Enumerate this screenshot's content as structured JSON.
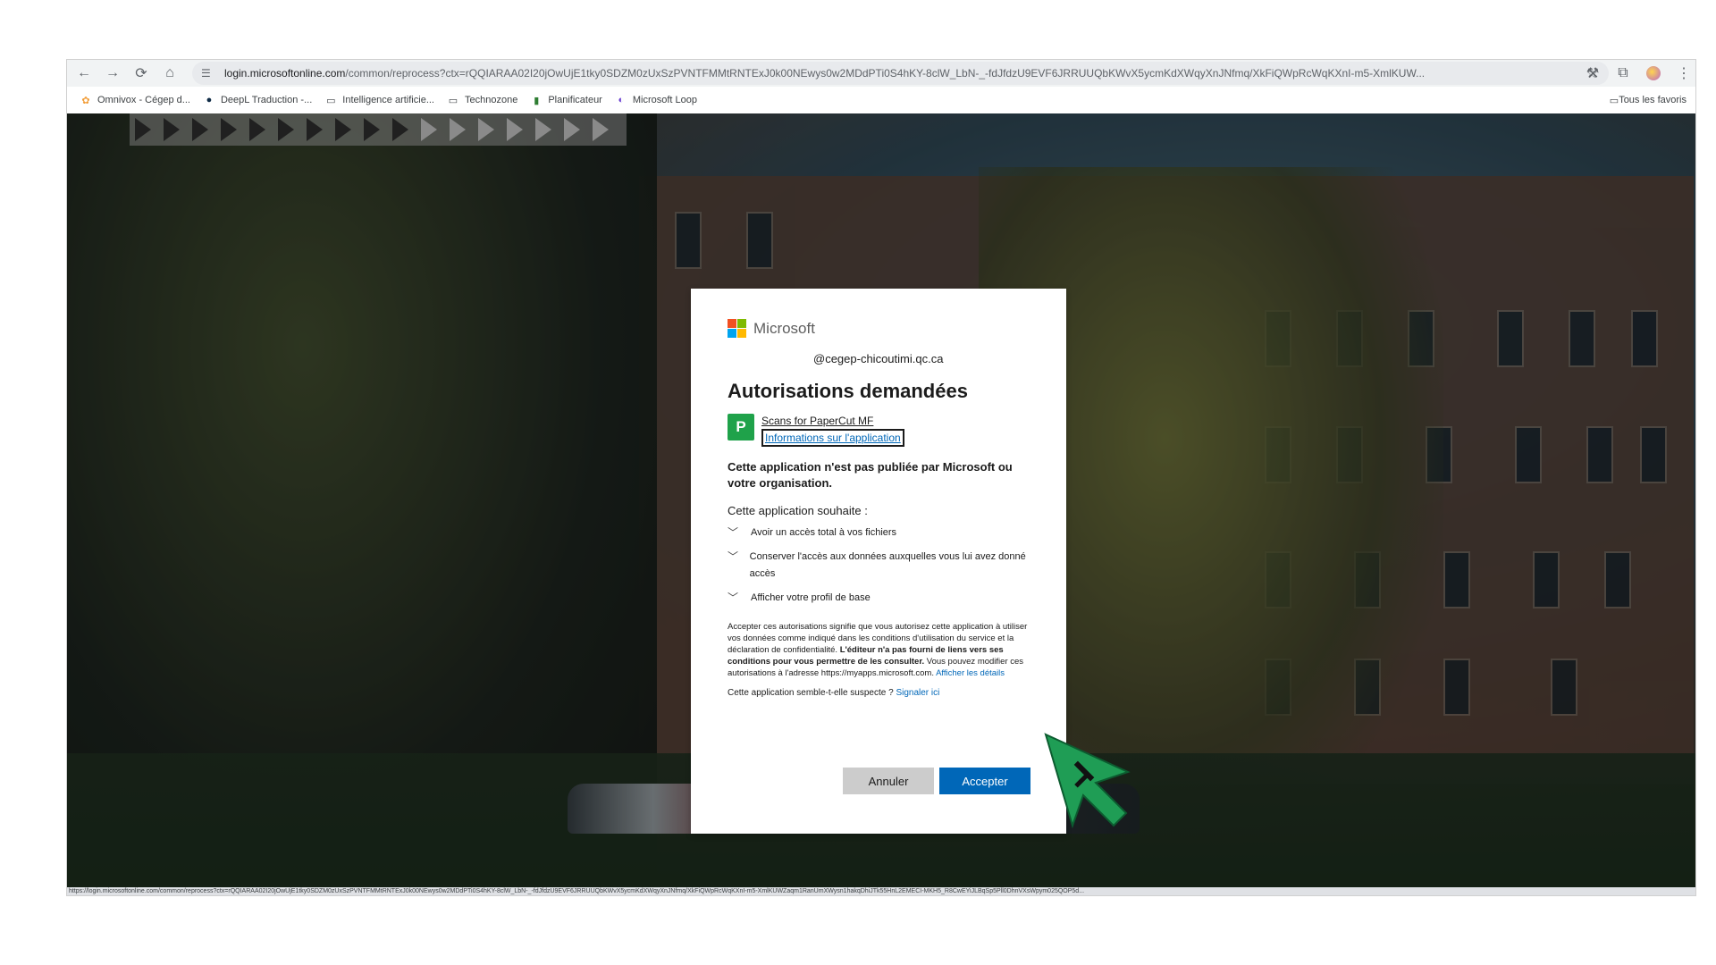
{
  "browser": {
    "url_host": "login.microsoftonline.com",
    "url_path": "/common/reprocess?ctx=rQQIARAA02I20jOwUjE1tky0SDZM0zUxSzPVNTFMMtRNTExJ0k00NEwys0w2MDdPTi0S4hKY-8clW_LbN-_-fdJfdzU9EVF6JRRUUQbKWvX5ycmKdXWqyXnJNfmq/XkFiQWpRcWqKXnI-m5-XmlKUW...",
    "bookmarks": [
      {
        "label": "Omnivox - Cégep d...",
        "icon": "omnivox-icon"
      },
      {
        "label": "DeepL Traduction -...",
        "icon": "deepl-icon"
      },
      {
        "label": "Intelligence artificie...",
        "icon": "folder-icon"
      },
      {
        "label": "Technozone",
        "icon": "folder-icon"
      },
      {
        "label": "Planificateur",
        "icon": "planner-icon"
      },
      {
        "label": "Microsoft Loop",
        "icon": "loop-icon"
      }
    ],
    "all_bookmarks_label": "Tous les favoris",
    "status_url": "https://login.microsoftonline.com/common/reprocess?ctx=rQQIARAA02I20jOwUjE1tky0SDZM0zUxSzPVNTFMMtRNTExJ0k00NEwys0w2MDdPTi0S4hKY-8clW_LbN-_-fdJfdzU9EVF6JRRUUQbKWvX5ycmKdXWqyXnJNfmq/XkFiQWpRcWqKXnI-m5-XmlKUWZaqm1RanUmXWysn1hakqDhiJTk55HnL2EMECI-MKH5_R8CwEYiJLBqSp5Pll0DhnVXsWpym025QOP5d..."
  },
  "dialog": {
    "brand": "Microsoft",
    "account": "@cegep-chicoutimi.qc.ca",
    "title": "Autorisations demandées",
    "app_name": "Scans for PaperCut MF",
    "app_info_link": "Informations sur l'application",
    "app_icon_letter": "P",
    "warning": "Cette application n'est pas publiée par Microsoft ou votre organisation.",
    "wants_label": "Cette application souhaite :",
    "permissions": [
      "Avoir un accès total à vos fichiers",
      "Conserver l'accès aux données auxquelles vous lui avez donné accès",
      "Afficher votre profil de base"
    ],
    "legal_part1": "Accepter ces autorisations signifie que vous autorisez cette application à utiliser vos données comme indiqué dans les conditions d'utilisation du service et la déclaration de confidentialité. ",
    "legal_bold": "L'éditeur n'a pas fourni de liens vers ses conditions pour vous permettre de les consulter.",
    "legal_part2": " Vous pouvez modifier ces autorisations à l'adresse https://myapps.microsoft.com. ",
    "legal_link": "Afficher les détails",
    "report_text": "Cette application semble-t-elle suspecte ? ",
    "report_link": "Signaler ici",
    "cancel_label": "Annuler",
    "accept_label": "Accepter"
  },
  "colors": {
    "accent": "#0067b8",
    "cursor": "#1f9d55",
    "app_icon": "#1fa24a"
  }
}
